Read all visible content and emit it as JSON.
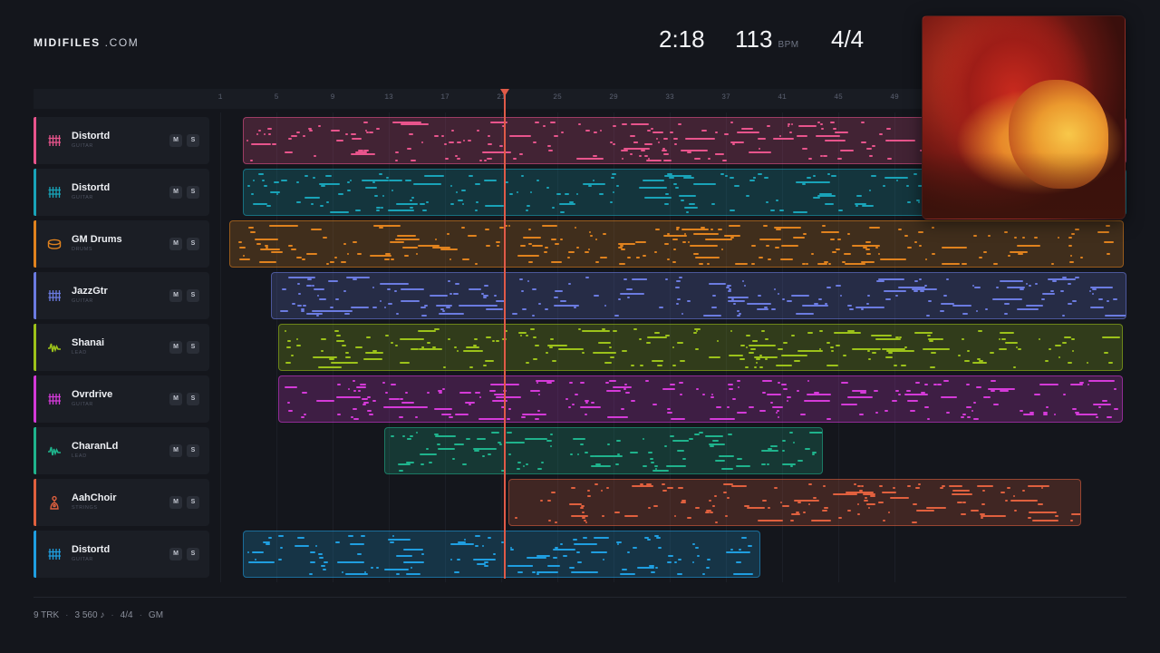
{
  "brand": {
    "name_bold": "MIDIFILES",
    "name_suffix": ".COM"
  },
  "header": {
    "time": "2:18",
    "bpm": "113",
    "bpm_unit": "BPM",
    "meter": "4/4"
  },
  "ruler": {
    "bars": [
      "1",
      "5",
      "9",
      "13",
      "17",
      "21",
      "25",
      "29",
      "33",
      "37",
      "41",
      "45",
      "49"
    ]
  },
  "playhead": {
    "bar": 21.2
  },
  "cover_art": {
    "icon": "album-cover-image"
  },
  "colors": {
    "pink": "#e8548c",
    "teal": "#19a3b8",
    "orange": "#e0821e",
    "periwinkle": "#6b7be0",
    "olive": "#9cc21a",
    "magenta": "#d43ad8",
    "green": "#1fb38c",
    "salmon": "#e0603e",
    "blue": "#1f9ee0"
  },
  "tracks": [
    {
      "name": "Distortd",
      "category": "GUITAR",
      "icon": "guitar-grid-icon",
      "color": "#e8548c",
      "mute": "M",
      "solo": "S"
    },
    {
      "name": "Distortd",
      "category": "GUITAR",
      "icon": "guitar-grid-icon",
      "color": "#19a3b8",
      "mute": "M",
      "solo": "S"
    },
    {
      "name": "GM Drums",
      "category": "DRUMS",
      "icon": "drum-icon",
      "color": "#e0821e",
      "mute": "M",
      "solo": "S"
    },
    {
      "name": "JazzGtr",
      "category": "GUITAR",
      "icon": "guitar-grid-icon",
      "color": "#6b7be0",
      "mute": "M",
      "solo": "S"
    },
    {
      "name": "Shanai",
      "category": "LEAD",
      "icon": "waveform-icon",
      "color": "#9cc21a",
      "mute": "M",
      "solo": "S"
    },
    {
      "name": "Ovrdrive",
      "category": "GUITAR",
      "icon": "guitar-grid-icon",
      "color": "#d43ad8",
      "mute": "M",
      "solo": "S"
    },
    {
      "name": "CharanLd",
      "category": "LEAD",
      "icon": "waveform-icon",
      "color": "#1fb38c",
      "mute": "M",
      "solo": "S"
    },
    {
      "name": "AahChoir",
      "category": "STRINGS",
      "icon": "person-voice-icon",
      "color": "#e0603e",
      "mute": "M",
      "solo": "S"
    },
    {
      "name": "Distortd",
      "category": "GUITAR",
      "icon": "guitar-grid-icon",
      "color": "#1f9ee0",
      "mute": "M",
      "solo": "S"
    }
  ],
  "footer": {
    "tracks": "9 TRK",
    "notes": "3 560 ♪",
    "meter": "4/4",
    "standard": "GM"
  }
}
